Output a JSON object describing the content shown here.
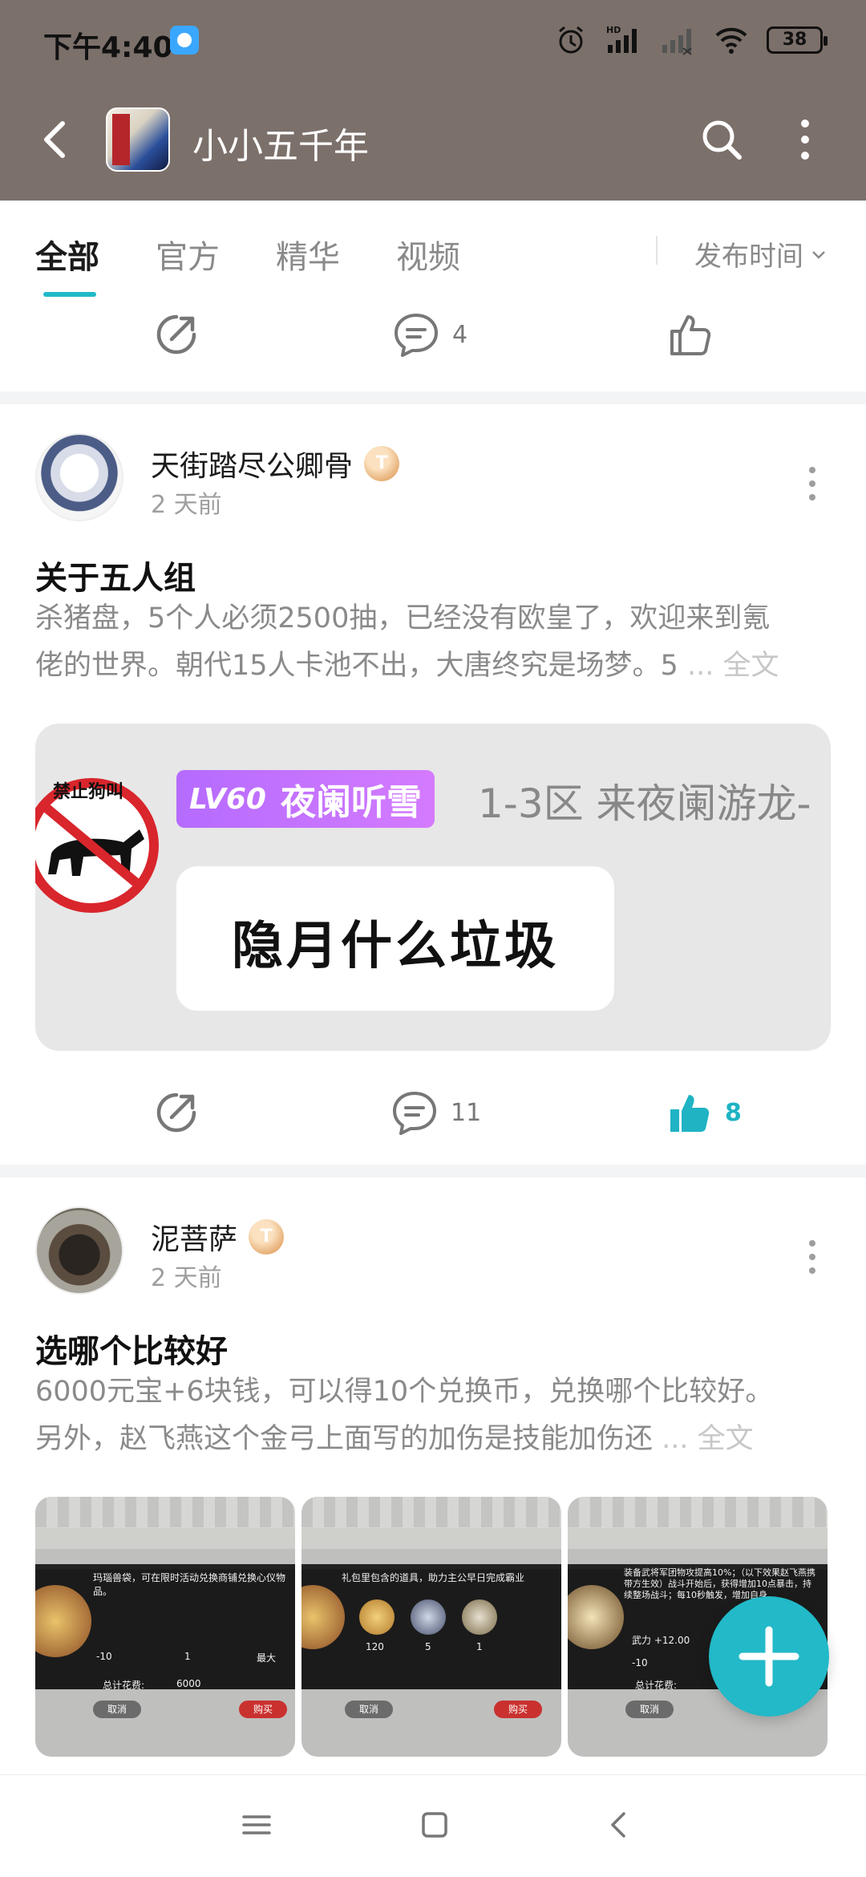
{
  "status_bar": {
    "time": "下午4:40",
    "battery": "38",
    "hd_label": "HD"
  },
  "header": {
    "title": "小小五千年"
  },
  "tabs": [
    {
      "label": "全部",
      "active": true
    },
    {
      "label": "官方",
      "active": false
    },
    {
      "label": "精华",
      "active": false
    },
    {
      "label": "视频",
      "active": false
    }
  ],
  "sort": {
    "label": "发布时间"
  },
  "top_actions": {
    "comment_count": "4"
  },
  "posts": [
    {
      "author": "天街踏尽公卿骨",
      "level": "T",
      "time_ago": "2 天前",
      "title": "关于五人组",
      "body_lines": [
        "杀猪盘，5个人必须2500抽，已经没有欧皇了，欢迎来到氪",
        "佬的世界。朝代15人卡池不出，大唐终究是场梦。5 "
      ],
      "ellipsis": "... ",
      "fulltext": "全文",
      "image": {
        "sign_text": "禁止狗叫",
        "level_tag": "LV60",
        "name_tag": "夜阑听雪",
        "region_text": "1-3区 来夜阑游龙-",
        "quote": "隐月什么垃圾"
      },
      "comment_count": "11",
      "like_count": "8"
    },
    {
      "author": "泥菩萨",
      "level": "T",
      "time_ago": "2 天前",
      "title": "选哪个比较好",
      "body_lines": [
        "6000元宝+6块钱，可以得10个兑换币，兑换哪个比较好。",
        "另外，赵飞燕这个金弓上面写的加伤是技能加伤还 "
      ],
      "ellipsis": "... ",
      "fulltext": "全文",
      "screenshots": [
        {
          "desc": "玛瑙兽袋，可在限时活动兑换商铺兑换心仪物品。",
          "minus10": "-10",
          "qty": "1",
          "max": "最大",
          "total_label": "总计花费:",
          "total": "6000",
          "cancel": "取消",
          "buy": "购买"
        },
        {
          "desc": "礼包里包含的道具，助力主公早日完成霸业",
          "item_counts": [
            "120",
            "5",
            "1"
          ],
          "cancel": "取消",
          "buy": "购买"
        },
        {
          "desc": "装备武将军团物攻提高10%；（以下效果赵飞燕携带方生效）战斗开始后，获得增加10点暴击，持续整场战斗；每10秒触发，增加自身",
          "stat": "武力 +12.00",
          "minus10": "-10",
          "total_label": "总计花费:",
          "cancel": "取消"
        }
      ]
    }
  ],
  "colors": {
    "header_bg": "#7c706b",
    "accent": "#22b9c8",
    "text_muted": "#8a8a8a"
  }
}
